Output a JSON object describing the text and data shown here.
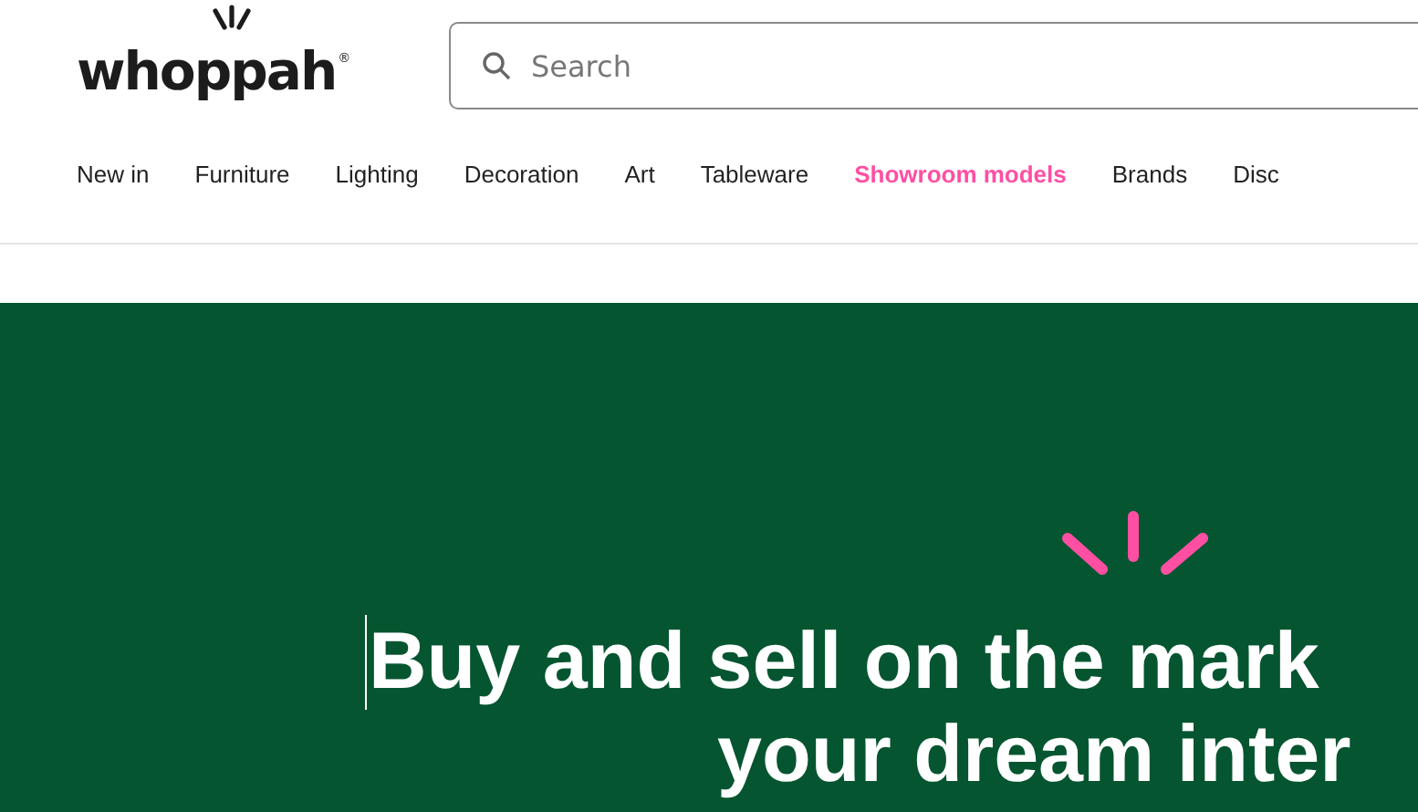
{
  "header": {
    "logo": {
      "text": "whoppah",
      "mark": "®"
    },
    "search": {
      "placeholder": "Search"
    }
  },
  "nav": [
    {
      "label": "New in",
      "selected": false
    },
    {
      "label": "Furniture",
      "selected": false
    },
    {
      "label": "Lighting",
      "selected": false
    },
    {
      "label": "Decoration",
      "selected": false
    },
    {
      "label": "Art",
      "selected": false
    },
    {
      "label": "Tableware",
      "selected": false
    },
    {
      "label": "Showroom models",
      "selected": true
    },
    {
      "label": "Brands",
      "selected": false
    },
    {
      "label": "Disc",
      "selected": false
    }
  ],
  "hero": {
    "lines": [
      "Buy and sell on the mark",
      "your dream inter"
    ]
  }
}
